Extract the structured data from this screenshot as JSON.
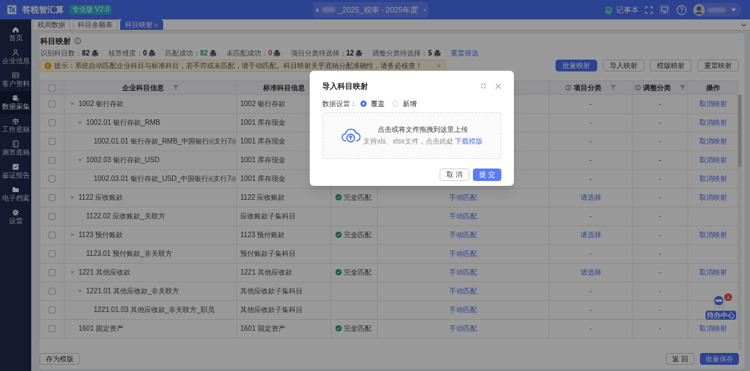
{
  "app": {
    "name": "答税智汇算",
    "edition": "专业版 V2.0",
    "project_title": "_2025_税审 · 2025年度",
    "notebook": "记事本"
  },
  "sidebar": {
    "items": [
      {
        "label": "首页",
        "selected": false
      },
      {
        "label": "企业信息",
        "selected": false
      },
      {
        "label": "客户资料",
        "selected": false
      },
      {
        "label": "数据采集",
        "selected": true
      },
      {
        "label": "工作底稿",
        "selected": false
      },
      {
        "label": "测算底稿",
        "selected": false
      },
      {
        "label": "鉴证报告",
        "selected": false
      },
      {
        "label": "电子档案",
        "selected": false
      },
      {
        "label": "设置",
        "selected": false
      }
    ]
  },
  "tabs": [
    {
      "label": "税局数据",
      "selected": false,
      "closable": false
    },
    {
      "label": "科目余额表",
      "selected": false,
      "closable": false
    },
    {
      "label": "科目映射",
      "selected": true,
      "closable": true
    }
  ],
  "page": {
    "title": "科目映射",
    "stats": [
      {
        "label": "识别科目数：",
        "value": "82",
        "unit": "条"
      },
      {
        "label": "核算维度：",
        "value": "0",
        "unit": "条"
      },
      {
        "label": "匹配成功：",
        "value": "82",
        "unit": "条",
        "color": "#106240"
      },
      {
        "label": "未匹配成功：",
        "value": "0",
        "unit": "条",
        "color": "#882323"
      },
      {
        "label": "项目分类待选择：",
        "value": "12",
        "unit": "条"
      },
      {
        "label": "调整分类待选择：",
        "value": "5",
        "unit": "条"
      }
    ],
    "reset_filter": "重置筛选",
    "alert": "提示：系统自动匹配企业科目与标准科目，若不符或未匹配，请手动匹配。科目映射关乎底稿分配准确性，请务必核查！",
    "actions": [
      {
        "label": "批量映射",
        "primary": true
      },
      {
        "label": "导入映射",
        "primary": false
      },
      {
        "label": "模版映射",
        "primary": false
      },
      {
        "label": "重置映射",
        "primary": false
      }
    ]
  },
  "table": {
    "all_checked": false,
    "columns": [
      {
        "label": "企业科目信息",
        "filter": true,
        "info": false
      },
      {
        "label": "标准科目信息",
        "filter": false,
        "info": false
      },
      {
        "label": "项目分类",
        "filter": true,
        "info": true
      },
      {
        "label": "调整分类",
        "filter": true,
        "info": true
      },
      {
        "label": "操作",
        "filter": false,
        "info": false
      }
    ],
    "rows": [
      {
        "name_parts": [
          "1002 银行存款"
        ],
        "standard": "1002 银行存款",
        "category": "-",
        "adjust": "-",
        "action": "取消映射",
        "checked": false,
        "expanded": true,
        "children": [
          {
            "name_parts": [
              "1002.01 银行存款_RMB"
            ],
            "standard": "1001 库存现金",
            "category": "-",
            "adjust": "-",
            "action": "取消映射",
            "checked": false,
            "expanded": true,
            "children": [
              {
                "name_parts": [
                  "1002.01.01 银行存款_RMB_中国银行",
                  "支行7"
                ],
                "standard": "1001 库存现金",
                "category": "-",
                "adjust": "-",
                "action": "取消映射",
                "checked": false
              }
            ]
          },
          {
            "name_parts": [
              "1002.03 银行存款_USD"
            ],
            "standard": "1001 库存现金",
            "category": "-",
            "adjust": "-",
            "action": "取消映射",
            "checked": false,
            "expanded": true,
            "children": [
              {
                "name_parts": [
                  "1002.03.01 银行存款_USD_中国银行",
                  "支行7"
                ],
                "standard": "1001 库存现金",
                "category": "-",
                "adjust": "-",
                "action": "取消映射",
                "checked": false
              }
            ]
          }
        ]
      },
      {
        "name_parts": [
          "1122 应收账款"
        ],
        "standard": "1122 应收账款",
        "status": "完全匹配",
        "match": "手动匹配",
        "category": "请选择",
        "adjust": "-",
        "action": "取消映射",
        "checked": false,
        "expanded": true,
        "children": [
          {
            "name_parts": [
              "1122.02 应收账款_关联方"
            ],
            "standard": "应收账款子集科目",
            "match": "手动匹配",
            "category": "-",
            "adjust": "-",
            "checked": false
          }
        ]
      },
      {
        "name_parts": [
          "1123 预付账款"
        ],
        "standard": "1123 预付账款",
        "status": "完全匹配",
        "match": "手动匹配",
        "category": "请选择",
        "adjust": "-",
        "action": "取消映射",
        "checked": false,
        "expanded": true,
        "children": [
          {
            "name_parts": [
              "1123.01 预付账款_非关联方"
            ],
            "standard": "预付账款子集科目",
            "match": "手动匹配",
            "category": "-",
            "adjust": "-",
            "checked": false
          }
        ]
      },
      {
        "name_parts": [
          "1221 其他应收款"
        ],
        "standard": "1221 其他应收款",
        "status": "完全匹配",
        "match": "手动匹配",
        "category": "请选择",
        "adjust": "-",
        "action": "取消映射",
        "checked": false,
        "expanded": true,
        "children": [
          {
            "name_parts": [
              "1221.01 其他应收款_非关联方"
            ],
            "standard": "其他应收款子集科目",
            "match": "手动匹配",
            "category": "-",
            "adjust": "-",
            "checked": false,
            "expanded": true,
            "children": [
              {
                "name_parts": [
                  "1221.01.03 其他应收款_非关联方_职员"
                ],
                "standard": "其他应收款子集科目",
                "match": "手动匹配",
                "category": "-",
                "adjust": "-",
                "checked": false
              }
            ]
          }
        ]
      },
      {
        "name_parts": [
          "1601 固定资产"
        ],
        "standard": "1601 固定资产",
        "status": "完全匹配",
        "match": "手动匹配",
        "category": "-",
        "adjust": "-",
        "action": "取消映射",
        "checked": false
      }
    ]
  },
  "footer": {
    "save_template": "存为模版",
    "back": "返 回",
    "batch_save": "批量保存"
  },
  "todo_widget": {
    "label": "待办中心",
    "badge": "1"
  },
  "dialog": {
    "title": "导入科目映射",
    "setting_label": "数据设置：",
    "options": [
      {
        "label": "覆盖",
        "selected": true
      },
      {
        "label": "新增",
        "selected": false
      }
    ],
    "upload_text": "点击或将文件拖拽到这里上传",
    "upload_hint": "支持xls、xlsx文件，点击此处",
    "upload_link": "下载模版",
    "cancel": "取 消",
    "submit": "提 交"
  }
}
